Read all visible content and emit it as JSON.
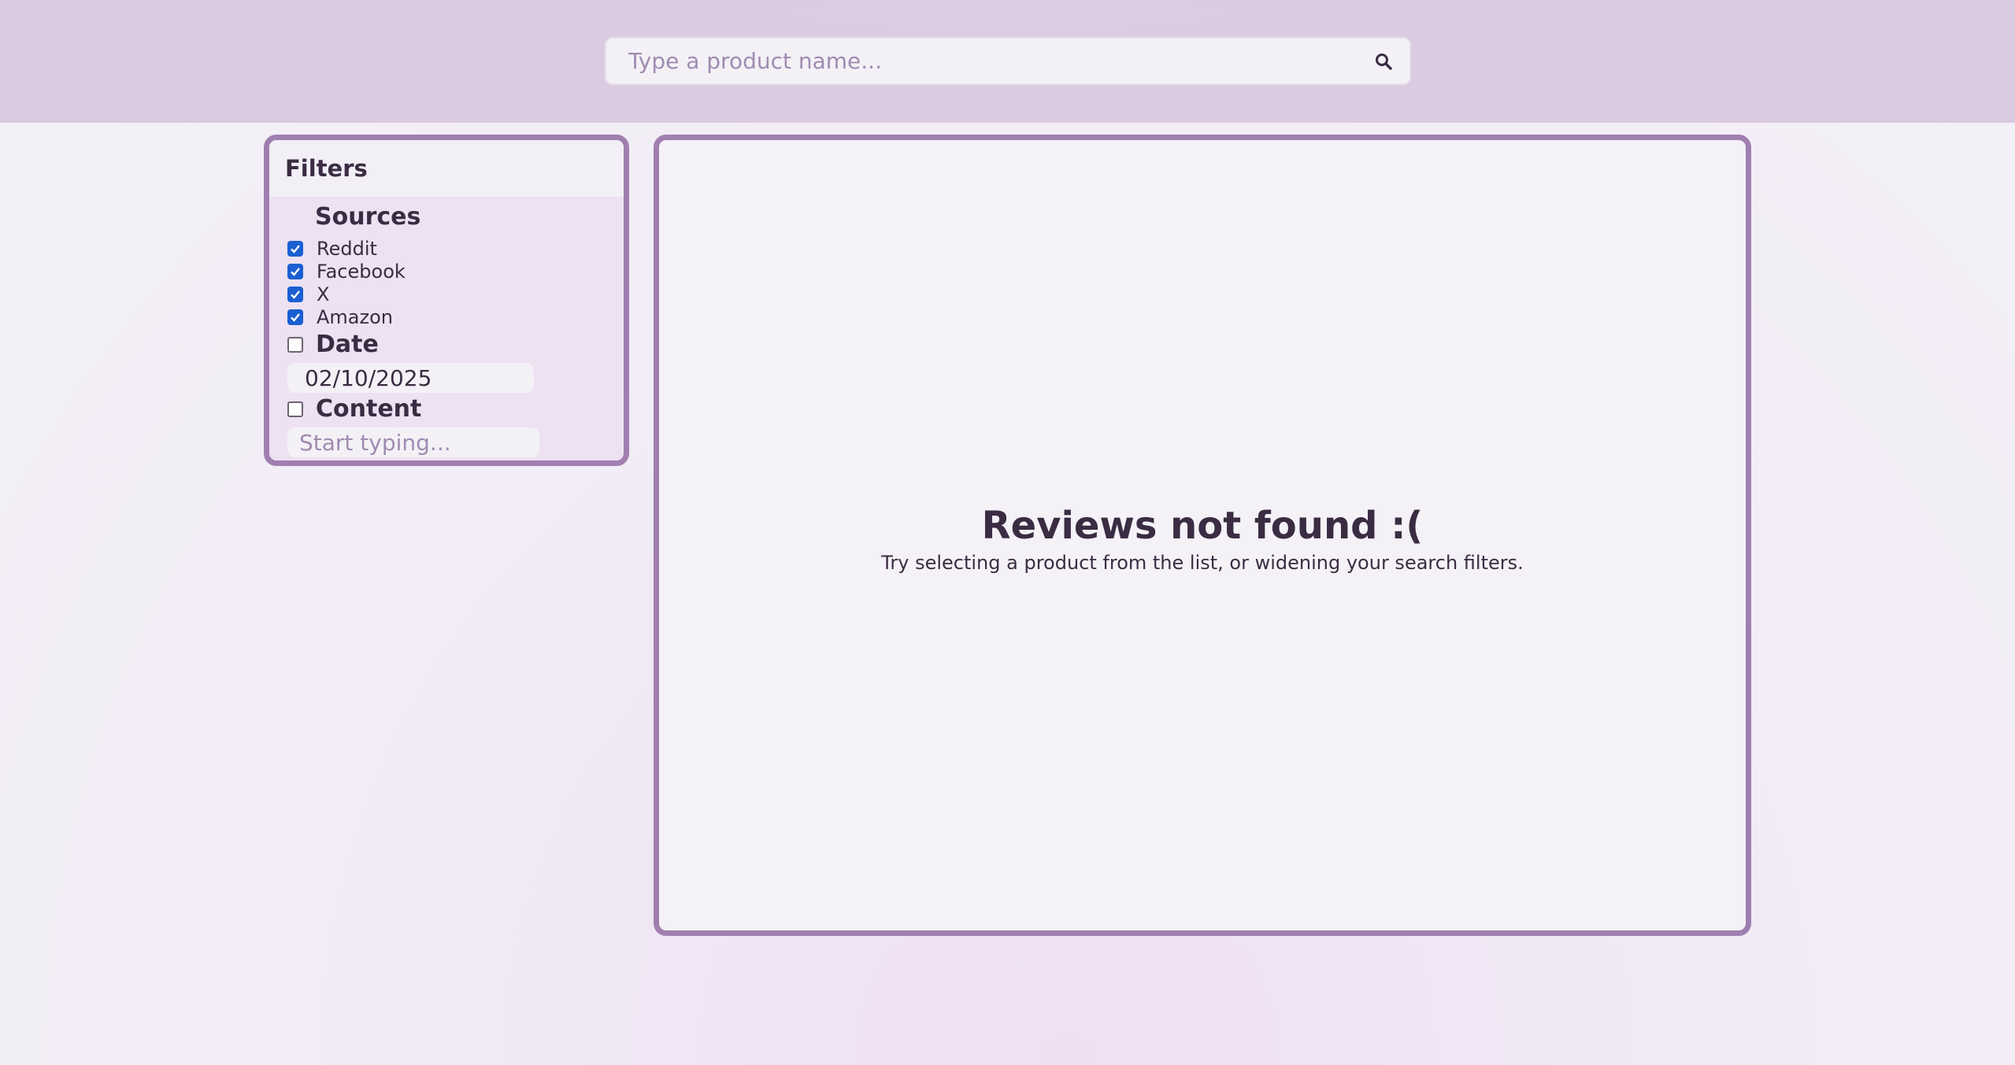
{
  "search": {
    "placeholder": "Type a product name...",
    "value": ""
  },
  "filters": {
    "title": "Filters",
    "sources": {
      "title": "Sources",
      "items": [
        {
          "label": "Reddit",
          "checked": true
        },
        {
          "label": "Facebook",
          "checked": true
        },
        {
          "label": "X",
          "checked": true
        },
        {
          "label": "Amazon",
          "checked": true
        }
      ]
    },
    "date": {
      "title": "Date",
      "enabled": false,
      "value": "02/10/2025"
    },
    "content": {
      "title": "Content",
      "enabled": false,
      "placeholder": "Start typing...",
      "value": ""
    }
  },
  "results": {
    "empty_title": "Reviews not found :(",
    "empty_message": "Try selecting a product from the list, or widening your search filters."
  },
  "icons": {
    "search": "search-icon",
    "checkbox_checked": "checkmark-icon"
  },
  "colors": {
    "accent_border": "#a07fb0",
    "checkbox": "#1a5fd1",
    "text": "#3a2c42",
    "placeholder": "#a08bb0"
  }
}
